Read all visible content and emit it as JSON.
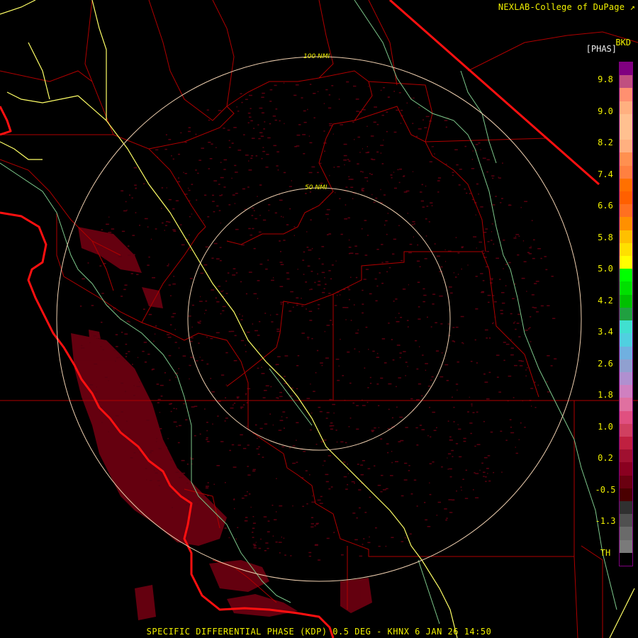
{
  "header": {
    "credit": "NEXLAB-College of DuPage",
    "site_code": "BKD",
    "units": "[PHAS]"
  },
  "rings": [
    {
      "label": "100 NMI"
    },
    {
      "label": "50 NMI"
    }
  ],
  "legend": {
    "ticks": [
      "9.8",
      "9.0",
      "8.2",
      "7.4",
      "6.6",
      "5.8",
      "5.0",
      "4.2",
      "3.4",
      "2.6",
      "1.8",
      "1.0",
      "0.2",
      "-0.5",
      "-1.3",
      "TH"
    ],
    "colors": [
      "#000000",
      "#7a7a7a",
      "#6a6a6a",
      "#505050",
      "#303030",
      "#4a0000",
      "#6a0010",
      "#8a0020",
      "#a01030",
      "#c02040",
      "#d04060",
      "#e05080",
      "#e070a0",
      "#d080c0",
      "#b090d0",
      "#90a0d0",
      "#70b0e0",
      "#50d0e0",
      "#40e0d0",
      "#20a040",
      "#00c000",
      "#00e000",
      "#00ff00",
      "#ffff00",
      "#ffe000",
      "#ffc000",
      "#ff9000",
      "#ff7020",
      "#ff6000",
      "#ff7000",
      "#ff8040",
      "#ff9050",
      "#ffb080",
      "#ffc090",
      "#ffc090",
      "#ffb080",
      "#ff9070",
      "#c05080",
      "#800080"
    ]
  },
  "footer": {
    "text": "SPECIFIC DIFFERENTIAL PHASE (KDP) 0.5 DEG - KHNX 6 JAN 26 14:50"
  },
  "colors": {
    "text": "#f0f000",
    "state_border": "#ff0000",
    "county_border": "#b00000",
    "highway": "#ffff66",
    "river": "#7ec98c",
    "rings": "#f0d0b0",
    "echo": "#6a0010"
  }
}
